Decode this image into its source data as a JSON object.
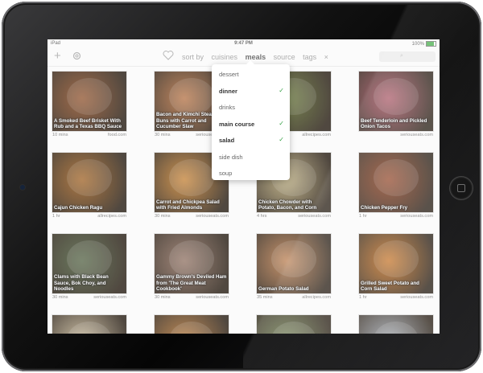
{
  "status": {
    "carrier": "iPad",
    "time": "9:47 PM",
    "battery": "100%"
  },
  "nav": {
    "add_icon": "+",
    "settings_icon": "gear-icon",
    "favorite_icon": "heart-icon",
    "links": [
      {
        "label": "sort by"
      },
      {
        "label": "cuisines"
      },
      {
        "label": "meals",
        "active": true
      },
      {
        "label": "source"
      },
      {
        "label": "tags"
      }
    ],
    "close": "×",
    "search_icon": "⌕"
  },
  "dropdown": [
    {
      "label": "dessert",
      "checked": false
    },
    {
      "label": "dinner",
      "checked": true
    },
    {
      "label": "drinks",
      "checked": false
    },
    {
      "label": "main course",
      "checked": true
    },
    {
      "label": "salad",
      "checked": true
    },
    {
      "label": "side dish",
      "checked": false
    },
    {
      "label": "soup",
      "checked": false
    }
  ],
  "recipes": [
    {
      "title": "A Smoked Beef Brisket With Rub and a Texas BBQ Sauce",
      "time": "10 mins",
      "source": "food.com",
      "color": "#8a4a22"
    },
    {
      "title": "Bacon and Kimchi Steamed Buns with Carrot and Cucumber Slaw",
      "time": "30 mins",
      "source": "seriouseats.com",
      "color": "#b06a3a"
    },
    {
      "title": "",
      "time": "",
      "source": "allrecipes.com",
      "color": "#5b6a2a"
    },
    {
      "title": "Beef Tenderloin and Pickled Onion Tacos",
      "time": "",
      "source": "seriouseats.com",
      "color": "#a34a5a"
    },
    {
      "title": "Cajun Chicken Ragu",
      "time": "1 hr",
      "source": "allrecipes.com",
      "color": "#9a5a1a"
    },
    {
      "title": "Carrot and Chickpea Salad with Fried Almonds",
      "time": "30 mins",
      "source": "seriouseats.com",
      "color": "#c07a2a"
    },
    {
      "title": "Chicken Chowder with Potato, Bacon, and Corn",
      "time": "4 hrs",
      "source": "seriouseats.com",
      "color": "#b0a070"
    },
    {
      "title": "Chicken Pepper Fry",
      "time": "1 hr",
      "source": "seriouseats.com",
      "color": "#8a3a1a"
    },
    {
      "title": "Clams with Black Bean Sauce, Bok Choy, and Noodles",
      "time": "30 mins",
      "source": "seriouseats.com",
      "color": "#4a5a3a"
    },
    {
      "title": "Gammy Brown's Deviled Ham from 'The Great Meat Cookbook'",
      "time": "30 mins",
      "source": "seriouseats.com",
      "color": "#8a6a5a"
    },
    {
      "title": "German Potato Salad",
      "time": "35 mins",
      "source": "allrecipes.com",
      "color": "#b87a4a"
    },
    {
      "title": "Grilled Sweet Potato and Corn Salad",
      "time": "1 hr",
      "source": "seriouseats.com",
      "color": "#c06a1a"
    },
    {
      "title": "",
      "time": "",
      "source": "",
      "color": "#c0b090"
    },
    {
      "title": "",
      "time": "",
      "source": "",
      "color": "#b07030"
    },
    {
      "title": "",
      "time": "",
      "source": "",
      "color": "#6a7a4a"
    },
    {
      "title": "",
      "time": "",
      "source": "",
      "color": "#9aa0a8"
    }
  ]
}
